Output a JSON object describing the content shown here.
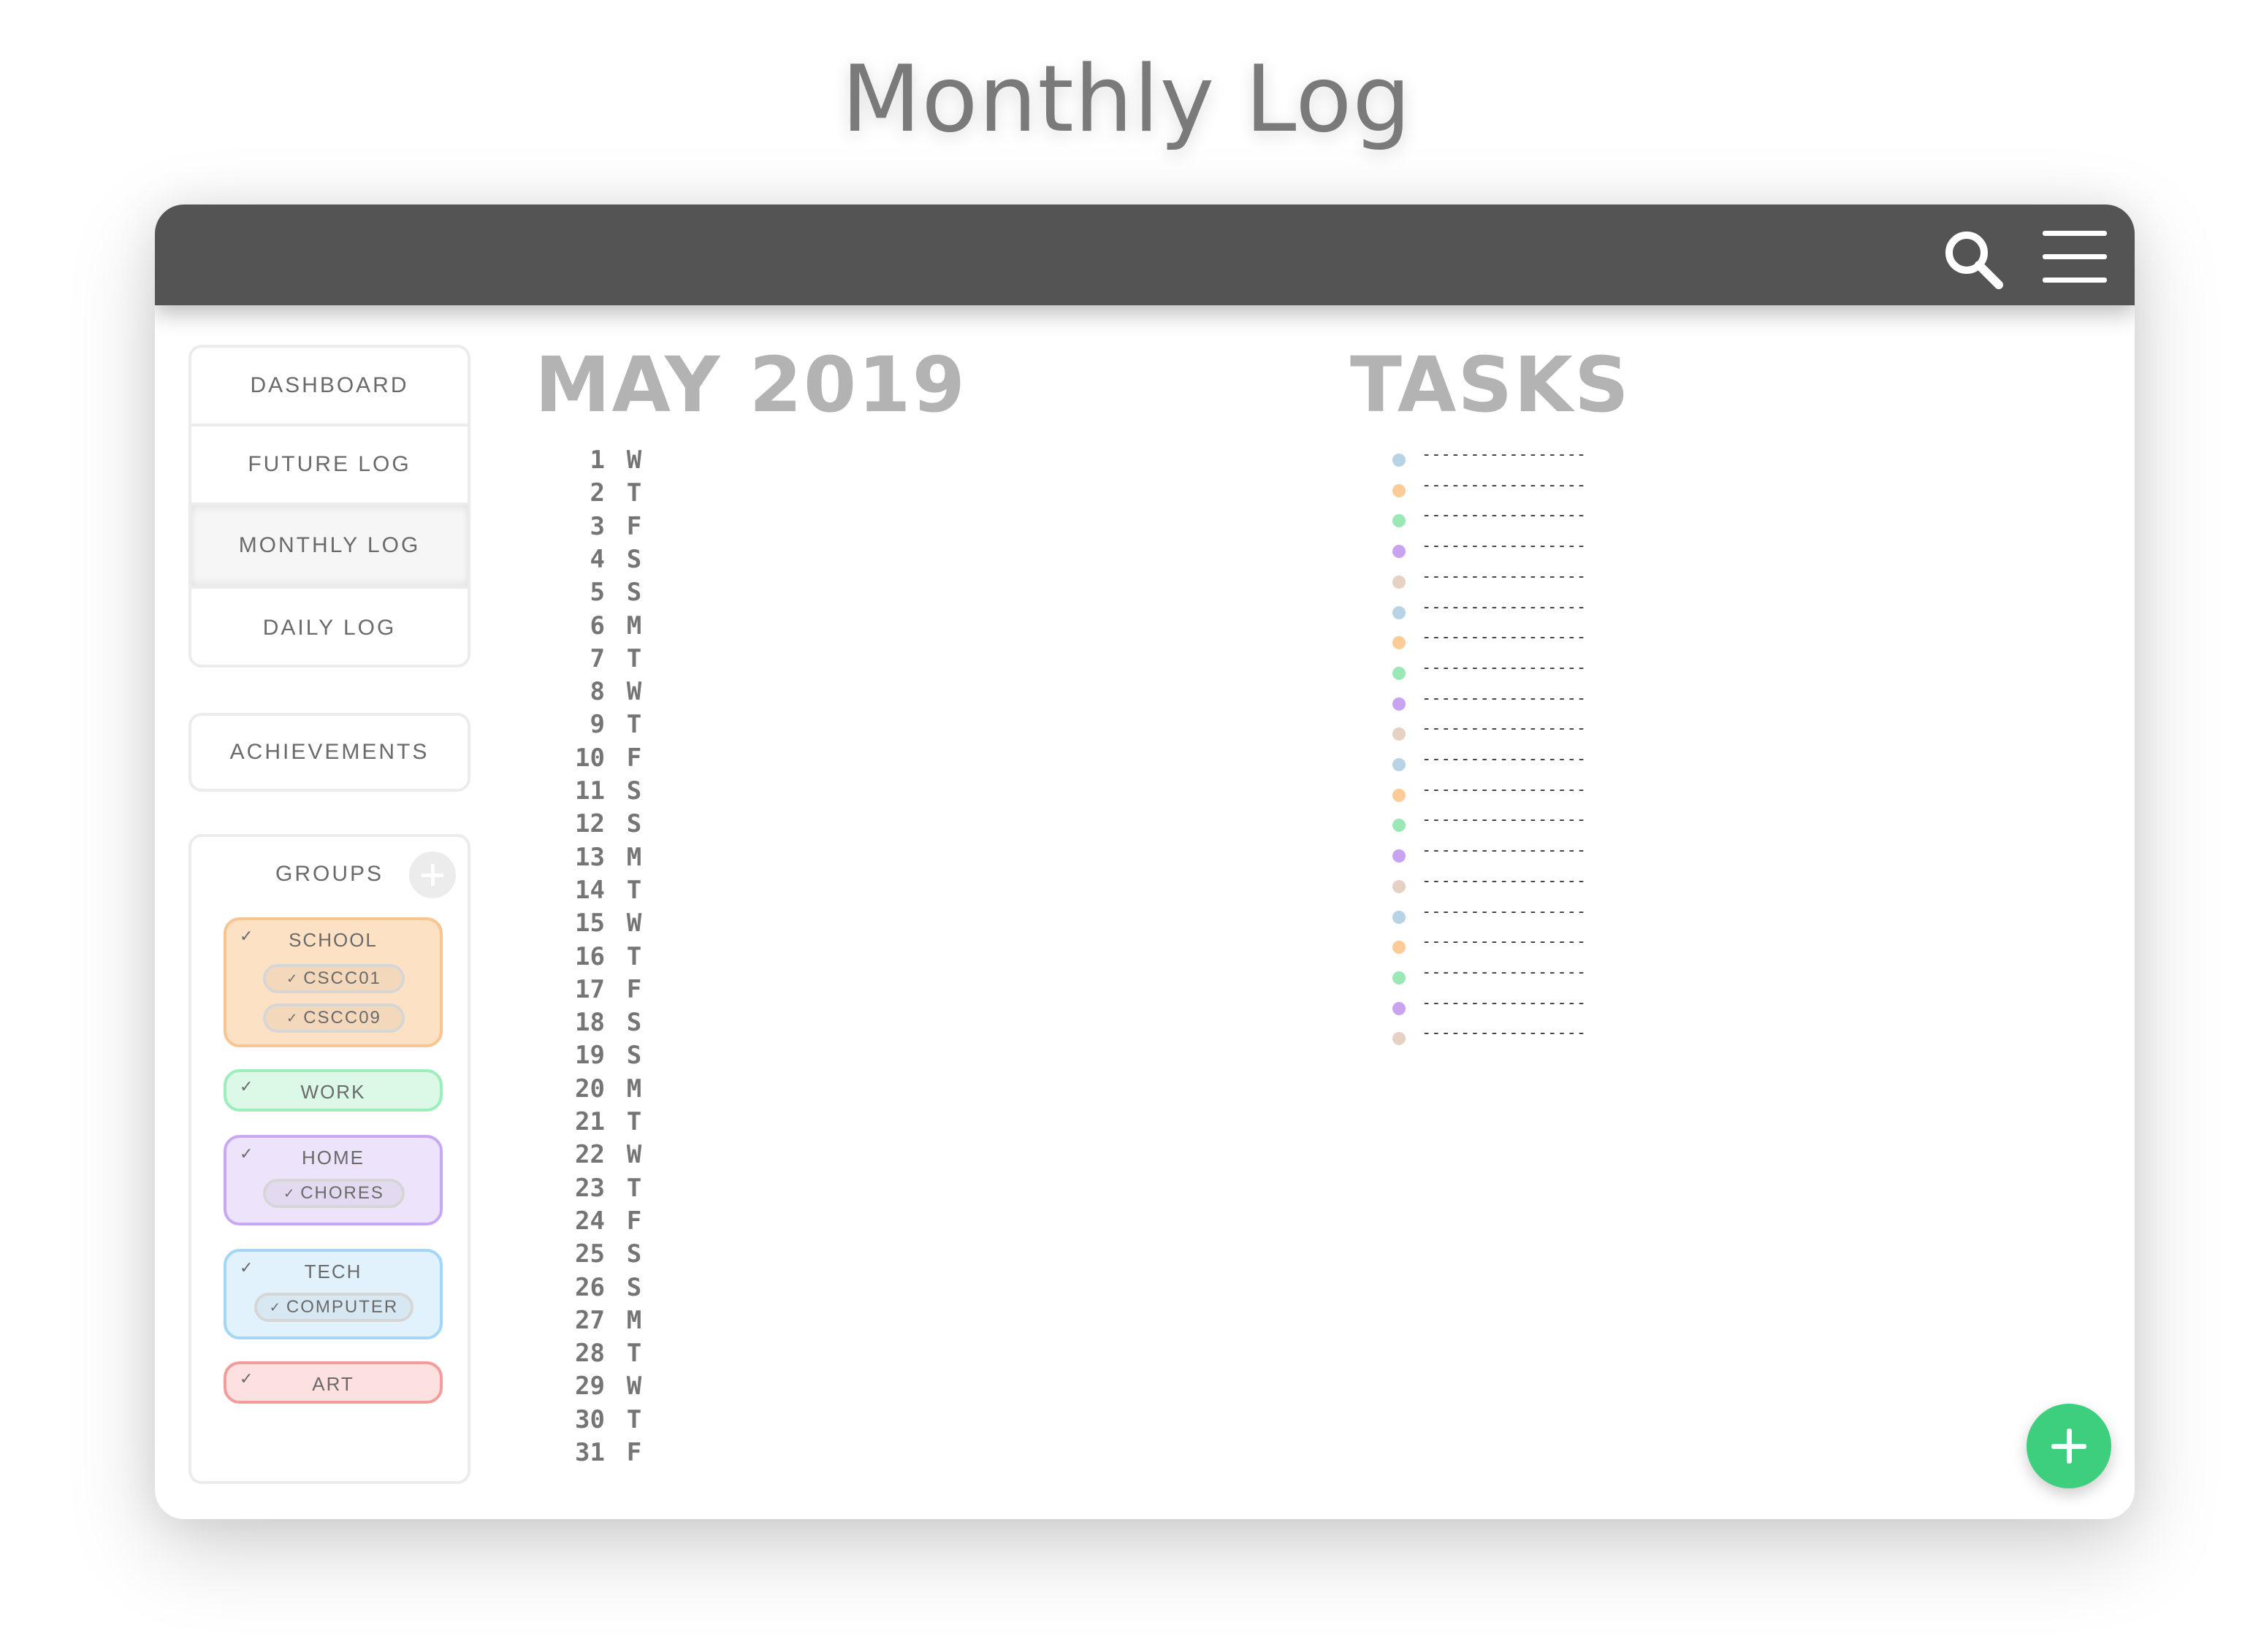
{
  "page_title": "Monthly Log",
  "toolbar": {
    "search_icon": "search-icon",
    "menu_icon": "hamburger-menu-icon",
    "bar_color": "#545454"
  },
  "sidebar": {
    "nav": [
      {
        "label": "DASHBOARD",
        "active": false
      },
      {
        "label": "FUTURE LOG",
        "active": false
      },
      {
        "label": "MONTHLY LOG",
        "active": true
      },
      {
        "label": "DAILY LOG",
        "active": false
      }
    ],
    "achievements_label": "ACHIEVEMENTS",
    "groups_title": "GROUPS",
    "groups": [
      {
        "label": "SCHOOL",
        "checked": true,
        "color": "#fde1c4",
        "border": "#f9c490",
        "subgroups": [
          {
            "label": "CSCC01",
            "checked": true
          },
          {
            "label": "CSCC09",
            "checked": true
          }
        ]
      },
      {
        "label": "WORK",
        "checked": true,
        "color": "#dcf8e6",
        "border": "#9deebd",
        "subgroups": []
      },
      {
        "label": "HOME",
        "checked": true,
        "color": "#ede3fb",
        "border": "#c9a8f3",
        "subgroups": [
          {
            "label": "CHORES",
            "checked": true
          }
        ]
      },
      {
        "label": "TECH",
        "checked": true,
        "color": "#e1f2fd",
        "border": "#a3d6f7",
        "subgroups": [
          {
            "label": "COMPUTER",
            "checked": true
          }
        ]
      },
      {
        "label": "ART",
        "checked": true,
        "color": "#fde0e0",
        "border": "#f49c9c",
        "subgroups": []
      }
    ]
  },
  "calendar": {
    "title": "MAY 2019",
    "days": [
      {
        "n": "1",
        "wd": "W"
      },
      {
        "n": "2",
        "wd": "T"
      },
      {
        "n": "3",
        "wd": "F"
      },
      {
        "n": "4",
        "wd": "S"
      },
      {
        "n": "5",
        "wd": "S"
      },
      {
        "n": "6",
        "wd": "M"
      },
      {
        "n": "7",
        "wd": "T"
      },
      {
        "n": "8",
        "wd": "W"
      },
      {
        "n": "9",
        "wd": "T"
      },
      {
        "n": "10",
        "wd": "F"
      },
      {
        "n": "11",
        "wd": "S"
      },
      {
        "n": "12",
        "wd": "S"
      },
      {
        "n": "13",
        "wd": "M"
      },
      {
        "n": "14",
        "wd": "T"
      },
      {
        "n": "15",
        "wd": "W"
      },
      {
        "n": "16",
        "wd": "T"
      },
      {
        "n": "17",
        "wd": "F"
      },
      {
        "n": "18",
        "wd": "S"
      },
      {
        "n": "19",
        "wd": "S"
      },
      {
        "n": "20",
        "wd": "M"
      },
      {
        "n": "21",
        "wd": "T"
      },
      {
        "n": "22",
        "wd": "W"
      },
      {
        "n": "23",
        "wd": "T"
      },
      {
        "n": "24",
        "wd": "F"
      },
      {
        "n": "25",
        "wd": "S"
      },
      {
        "n": "26",
        "wd": "S"
      },
      {
        "n": "27",
        "wd": "M"
      },
      {
        "n": "28",
        "wd": "T"
      },
      {
        "n": "29",
        "wd": "W"
      },
      {
        "n": "30",
        "wd": "T"
      },
      {
        "n": "31",
        "wd": "F"
      }
    ]
  },
  "tasks": {
    "title": "TASKS",
    "items": [
      {
        "text": "-----------------",
        "color": "#b9d3e6"
      },
      {
        "text": "-----------------",
        "color": "#fbcb98"
      },
      {
        "text": "-----------------",
        "color": "#9be8b7"
      },
      {
        "text": "-----------------",
        "color": "#c9a3f2"
      },
      {
        "text": "-----------------",
        "color": "#e6d2c4"
      },
      {
        "text": "-----------------",
        "color": "#b9d3e6"
      },
      {
        "text": "-----------------",
        "color": "#fbcb98"
      },
      {
        "text": "-----------------",
        "color": "#9be8b7"
      },
      {
        "text": "-----------------",
        "color": "#c9a3f2"
      },
      {
        "text": "-----------------",
        "color": "#e6d2c4"
      },
      {
        "text": "-----------------",
        "color": "#b9d3e6"
      },
      {
        "text": "-----------------",
        "color": "#fbcb98"
      },
      {
        "text": "-----------------",
        "color": "#9be8b7"
      },
      {
        "text": "-----------------",
        "color": "#c9a3f2"
      },
      {
        "text": "-----------------",
        "color": "#e6d2c4"
      },
      {
        "text": "-----------------",
        "color": "#b9d3e6"
      },
      {
        "text": "-----------------",
        "color": "#fbcb98"
      },
      {
        "text": "-----------------",
        "color": "#9be8b7"
      },
      {
        "text": "-----------------",
        "color": "#c9a3f2"
      },
      {
        "text": "-----------------",
        "color": "#e6d2c4"
      }
    ]
  },
  "fab_icon": "plus-icon",
  "fab_color": "#3ecf7e"
}
